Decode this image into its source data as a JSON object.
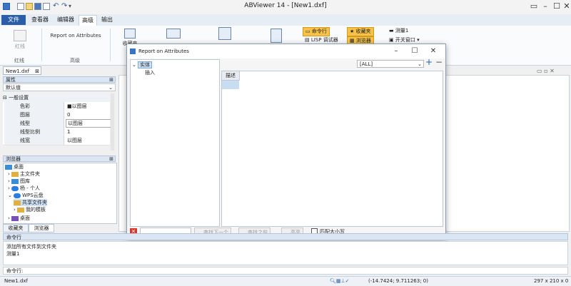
{
  "window": {
    "title": "ABViewer 14 - [New1.dxf]",
    "min": "–",
    "max": "☐",
    "close": "✕"
  },
  "menu": {
    "tabs": [
      "文件",
      "查看器",
      "编辑器",
      "高级",
      "输出"
    ],
    "active": "高级"
  },
  "ribbon": {
    "redline_label": "红线",
    "redline_group": "红线",
    "report_label": "Report on Attributes",
    "advanced_group": "高级",
    "fav_label": "收藏夹",
    "cmdline_label": "命令行",
    "lisp_label": "LISP 调试器",
    "favorites_label": "收藏夹",
    "browser_label": "浏览器",
    "measure_label": "测量1",
    "openwin_label": "开关窗口"
  },
  "doc_tab": {
    "label": "New1.dxf"
  },
  "properties": {
    "header": "属性",
    "default_value": "默认值",
    "section": "一般设置",
    "rows": [
      {
        "key": "色彩",
        "value": "■以图层"
      },
      {
        "key": "图层",
        "value": "0"
      },
      {
        "key": "线型",
        "value": "以图层"
      },
      {
        "key": "线型比例",
        "value": "1"
      },
      {
        "key": "线宽",
        "value": "以图层"
      }
    ]
  },
  "browser": {
    "header": "浏览器",
    "items": [
      "桌面",
      "主文件夹",
      "图库",
      "杨 - 个人",
      "WPS云盘",
      "共享文件夹",
      "我的模板",
      "桌面"
    ],
    "tabs": [
      "收藏夹",
      "浏览器"
    ]
  },
  "dialog": {
    "title": "Report on Attributes",
    "min": "–",
    "max": "☐",
    "close": "✕",
    "tree_root": "实体",
    "tree_child": "插入",
    "filter_value": "[ALL]",
    "add": "+",
    "remove": "−",
    "col_header": "描述",
    "find_next": "查找下一个",
    "find_prev": "查找之前",
    "highlight": "高亮",
    "match_case": "匹配大小写"
  },
  "command": {
    "header": "命令行",
    "lines": [
      "添加所有文件到文件夹",
      "测量1"
    ],
    "prompt_label": "命令行:"
  },
  "status": {
    "file": "New1.dxf",
    "coords": "(-14.7424; 9.711263; 0)",
    "size": "297 x 210 x 0"
  }
}
